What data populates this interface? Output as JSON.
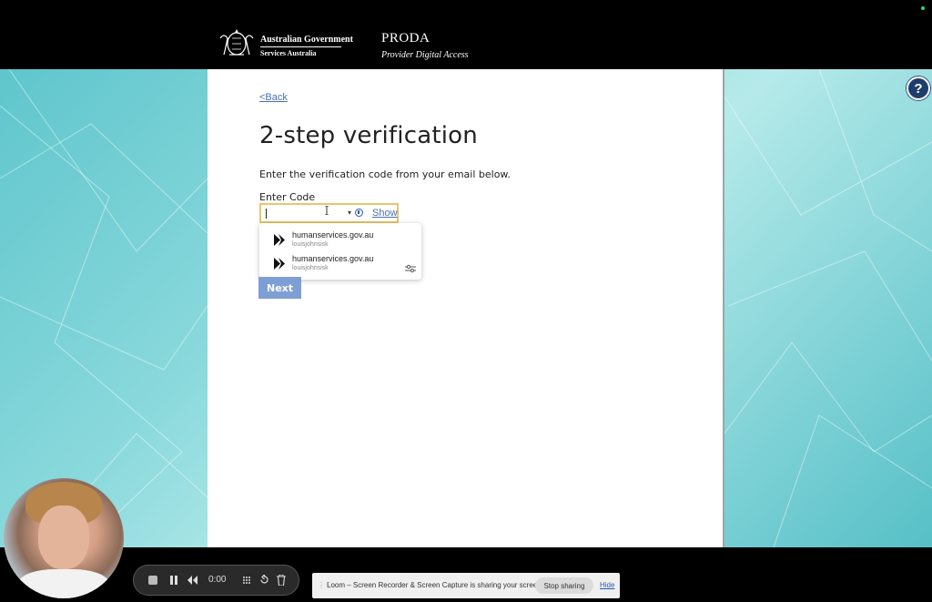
{
  "header": {
    "gov_title": "Australian Government",
    "gov_sub": "Services Australia",
    "app_title": "PRODA",
    "app_subtitle": "Provider Digital Access"
  },
  "help_label": "?",
  "content": {
    "back_link": "<Back",
    "title": "2-step verification",
    "instruction": "Enter the verification code from your email below.",
    "code_label": "Enter Code",
    "code_value": "",
    "show_label": "Show",
    "next_label": "Next"
  },
  "autofill": {
    "items": [
      {
        "site": "humanservices.gov.au",
        "user": "louisjohnsisk"
      },
      {
        "site": "humanservices.gov.au",
        "user": "louisjohnsisk"
      }
    ]
  },
  "recorder": {
    "time": "0:00"
  },
  "sharing_bar": {
    "message": "Loom – Screen Recorder & Screen Capture is sharing your screen.",
    "stop_label": "Stop sharing",
    "hide_label": "Hide"
  },
  "colors": {
    "header_bg": "#000000",
    "teal_bg": "#8ad9dc",
    "link": "#4a6fb5",
    "input_border": "#e8c66a",
    "next_button": "#7e9fd6",
    "help_button": "#1f3d6b"
  },
  "icons": [
    "crest-icon",
    "help-icon",
    "key-icon",
    "chevron-down-icon",
    "autofill-play-icon",
    "settings-sliders-icon",
    "stop-icon",
    "pause-icon",
    "rewind-icon",
    "grid-icon",
    "restart-icon",
    "trash-icon"
  ]
}
